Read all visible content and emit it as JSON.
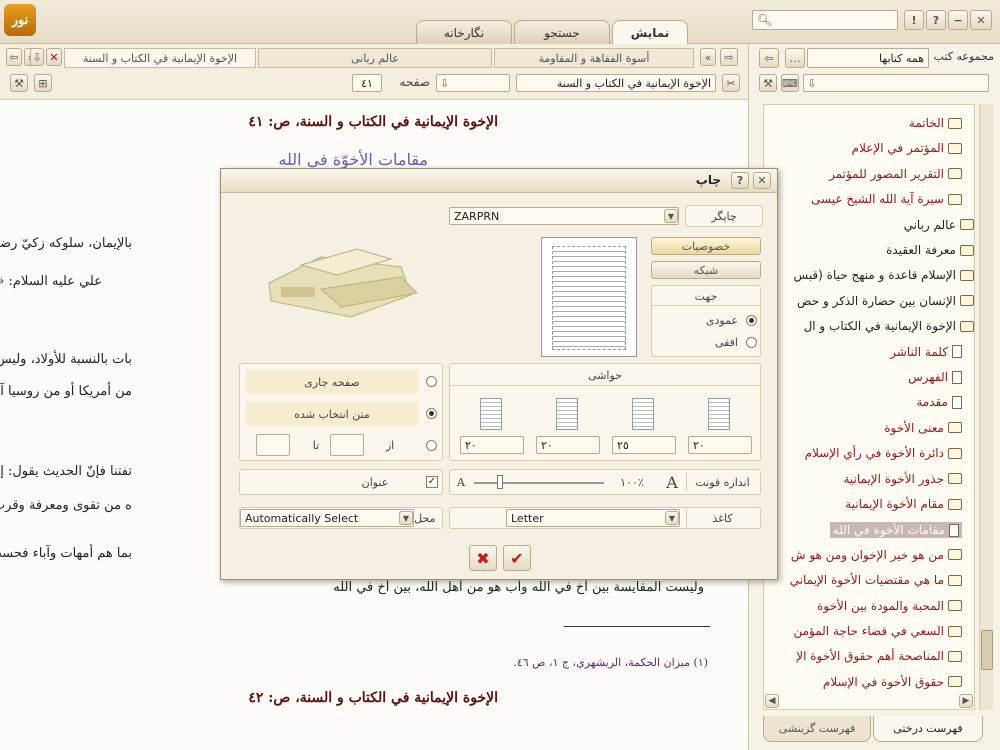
{
  "app": {
    "logo_text": "نور",
    "tabs": [
      "نمایش",
      "جستجو",
      "نگارخانه"
    ],
    "active_tab": "نمایش",
    "search_icon": "search-icon"
  },
  "doc_tabs": [
    {
      "label": "الإخوة الإيمانية في الكتاب و السنة"
    },
    {
      "label": "عالم ربانی"
    },
    {
      "label": "أسوة الفقاهة و المقاومة"
    }
  ],
  "toolbar": {
    "page_label": "صفحه",
    "page_value": "٤١",
    "title_field": "الإخوة الإيمانية في الكتاب و السنة"
  },
  "content": {
    "heading_top": "الإخوة الإيمانية في الكتاب و السنة، ص: ٤١",
    "section_title": "مقامات الأخوّة في الله",
    "p1": "بالإيمان، سلوكه زكيّ رضيّ،",
    "p2": "علي عليه السلام: «",
    "p3": "بات بالنسبة للأولاد، وليس من",
    "p4": "من أمريكا أو من روسيا آخيته",
    "p5": "تفتنا فإنّ الحديث يقول: إنّ هذا",
    "p6": "ه من تقوى ومعرفة وقرب لله",
    "p7": "بما هم أمهات وآباء فحسب،",
    "p8": "وليست المقايسة بين أخ في الله وأب هو من أهل الله، بين أخ في الله",
    "footnote": "(١) ميزان الحكمة، الريشهري، ج ١، ص ٤٦.",
    "heading_bottom": "الإخوة الإيمانية في الكتاب و السنة، ص: ٤٢"
  },
  "sidebar": {
    "collection_label": "مجموعه کتب",
    "collection_value": "همه کتابها",
    "tree": [
      {
        "label": "الخاتمة",
        "style": "red",
        "icon": "book"
      },
      {
        "label": "المؤتمر في الإعلام",
        "style": "red",
        "icon": "book"
      },
      {
        "label": "التقرير المصور للمؤتمر",
        "style": "red",
        "icon": "book"
      },
      {
        "label": "سيرة آية الله الشيخ عيسى",
        "style": "red",
        "icon": "book"
      },
      {
        "label": "عالم رباني",
        "style": "black",
        "icon": "book"
      },
      {
        "label": "معرفة العقيدة",
        "style": "black",
        "icon": "book"
      },
      {
        "label": "الإسلام قاعدة و منهج حياة (قبس",
        "style": "black",
        "icon": "book"
      },
      {
        "label": "الإنسان بين حضارة الذكر و حض",
        "style": "black",
        "icon": "book"
      },
      {
        "label": "الإخوة الإيمانية في الكتاب و ال",
        "style": "black",
        "icon": "openbook"
      },
      {
        "label": "كلمة الناشر",
        "style": "red",
        "icon": "page"
      },
      {
        "label": "الفهرس",
        "style": "red",
        "icon": "page"
      },
      {
        "label": "مقدمة",
        "style": "red",
        "icon": "page"
      },
      {
        "label": "معنى الأخوة",
        "style": "red",
        "icon": "book"
      },
      {
        "label": "دائرة الأخوة في رأي الإسلام",
        "style": "red",
        "icon": "book"
      },
      {
        "label": "جذور الأخوة الإيمانية",
        "style": "red",
        "icon": "book"
      },
      {
        "label": "مقام الأخوة الإيمانية",
        "style": "red",
        "icon": "book"
      },
      {
        "label": "مقامات الأخوة في الله",
        "style": "selected",
        "icon": "page"
      },
      {
        "label": "من هو خير الإخوان ومن هو ش",
        "style": "red",
        "icon": "book"
      },
      {
        "label": "ما هي مقتضيات الأخوة الإيماني",
        "style": "red",
        "icon": "book"
      },
      {
        "label": "المحبة والمودة بين الأخوة",
        "style": "red",
        "icon": "book"
      },
      {
        "label": "السعي في قضاء حاجة المؤمن",
        "style": "red",
        "icon": "book"
      },
      {
        "label": "المناصحة أهم حقوق الأخوة الإ",
        "style": "red",
        "icon": "book"
      },
      {
        "label": "حقوق الأخوة في الإسلام",
        "style": "red",
        "icon": "book"
      }
    ],
    "bottom_tabs": [
      "فهرست درختی",
      "فهرست گزینشی"
    ]
  },
  "dialog": {
    "title": "چاپ",
    "printer_label": "چاپگر",
    "printer_value": "ZARPRN",
    "properties_button": "خصوصیات",
    "network_button": "شبکه",
    "orientation_label": "جهت",
    "portrait_label": "عمودی",
    "landscape_label": "افقی",
    "orientation_selected": "عمودی",
    "margins_label": "حواشی",
    "margins": [
      "٢٠",
      "٢٠",
      "٢٥",
      "٢٠"
    ],
    "range_current_page": "صفحه جاری",
    "range_selected_text": "متن انتخاب شده",
    "range_selected": "متن انتخاب شده",
    "range_from": "از",
    "range_to": "تا",
    "title_checkbox": "عنوان",
    "title_checked": true,
    "font_size_label": "اندازه فونت",
    "font_size_value": "١٠٠٪",
    "font_size_fraction": 0.2,
    "paper_label": "کاغذ",
    "paper_value": "Letter",
    "paper_source_label": "محل کاغذ",
    "paper_source_value": "Automatically Select",
    "colors": {
      "cancel": "#c81818",
      "ok": "#c81818"
    }
  },
  "colors": {
    "accent_red": "#8b1a1a",
    "heading_purple": "#5a2a7a",
    "selected_bg": "#c9b8b0"
  }
}
